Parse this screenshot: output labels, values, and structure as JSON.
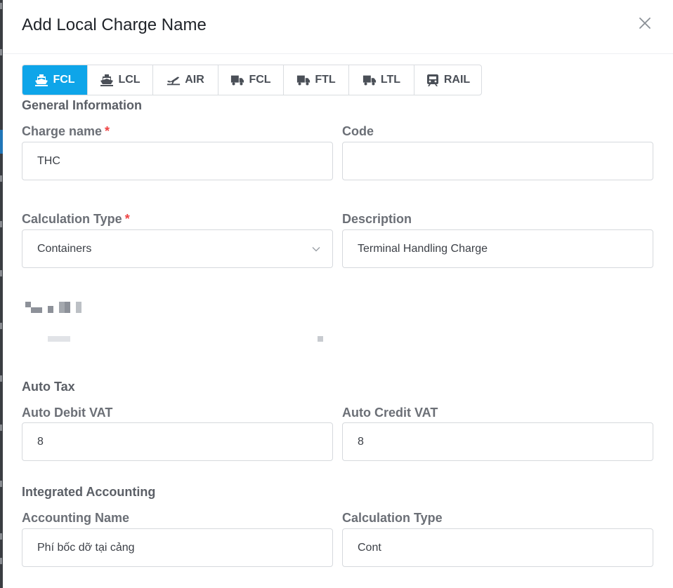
{
  "modal": {
    "title": "Add Local Charge Name",
    "close_icon": "close-icon"
  },
  "tabs": [
    {
      "label": "FCL",
      "icon": "ship-icon",
      "active": true
    },
    {
      "label": "LCL",
      "icon": "ship-icon",
      "active": false
    },
    {
      "label": "AIR",
      "icon": "plane-icon",
      "active": false
    },
    {
      "label": "FCL",
      "icon": "truck-icon",
      "active": false
    },
    {
      "label": "FTL",
      "icon": "truck-icon",
      "active": false
    },
    {
      "label": "LTL",
      "icon": "truck-icon",
      "active": false
    },
    {
      "label": "RAIL",
      "icon": "train-icon",
      "active": false
    }
  ],
  "general": {
    "title": "General Information",
    "charge_name_label": "Charge name",
    "charge_name_value": "THC",
    "code_label": "Code",
    "code_value": "",
    "calc_type_label": "Calculation Type",
    "calc_type_value": "Containers",
    "description_label": "Description",
    "description_value": "Terminal Handling Charge",
    "required_mark": "*"
  },
  "auto_tax": {
    "title": "Auto Tax",
    "debit_label": "Auto Debit VAT",
    "debit_value": "8",
    "credit_label": "Auto Credit VAT",
    "credit_value": "8"
  },
  "accounting": {
    "title": "Integrated Accounting",
    "name_label": "Accounting Name",
    "name_value": "Phí bốc dỡ tại cảng",
    "calc_label": "Calculation Type",
    "calc_value": "Cont"
  },
  "colors": {
    "accent": "#0ea5e9",
    "required": "#ef4444"
  }
}
